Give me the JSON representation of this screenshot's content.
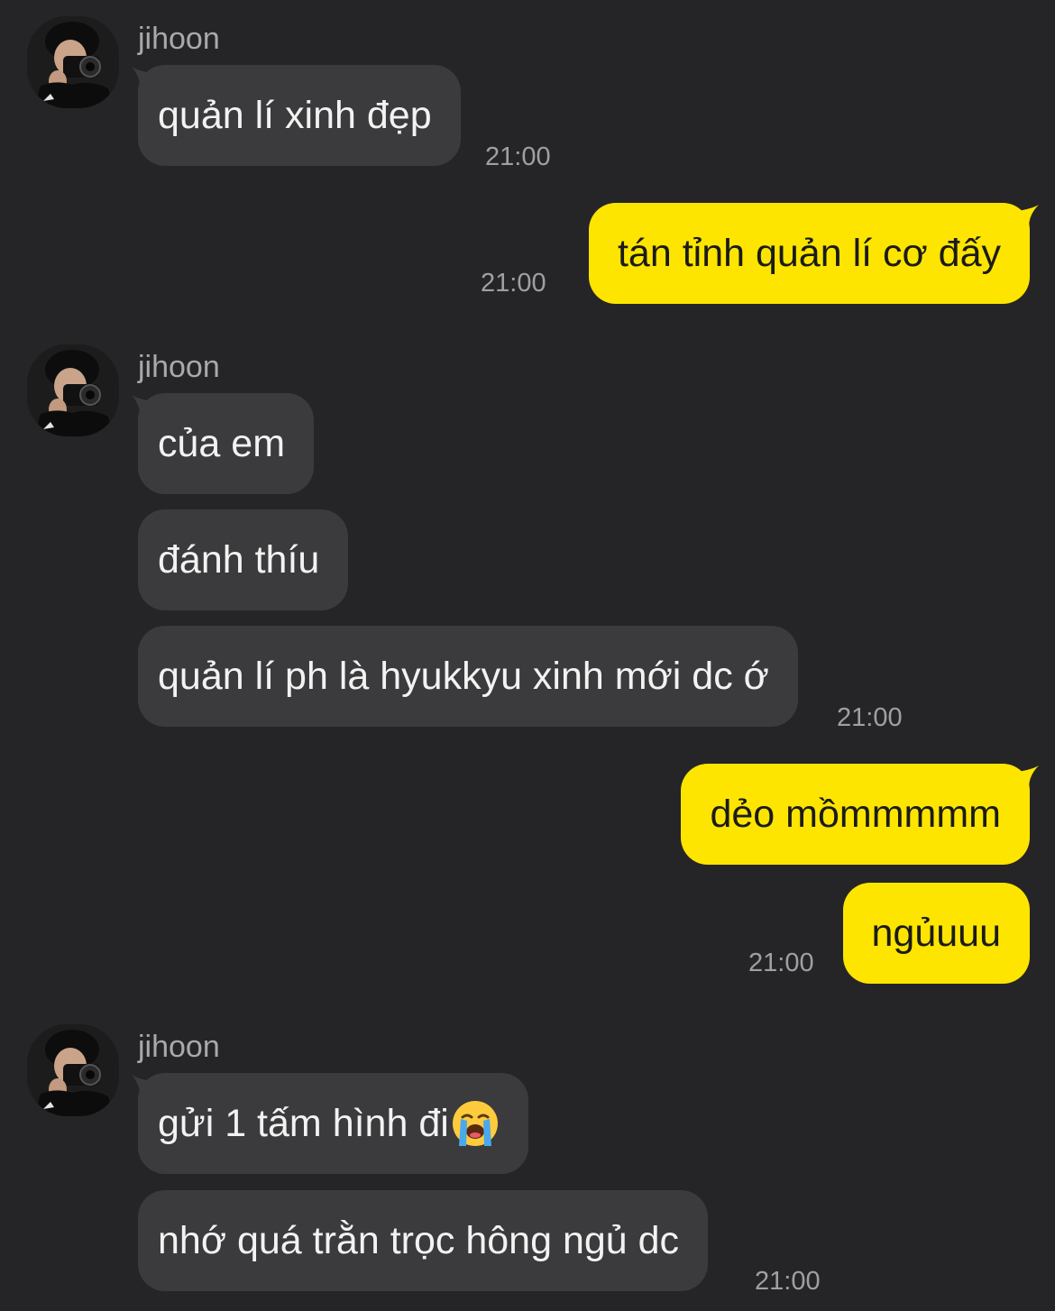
{
  "colors": {
    "background": "#252527",
    "incoming_bubble": "#3b3b3d",
    "outgoing_bubble": "#fde500",
    "incoming_text": "#f2f2f2",
    "outgoing_text": "#1b1b1b",
    "meta_text": "#a0a0a2"
  },
  "contact": {
    "name": "jihoon",
    "avatar_icon": "profile-photo-camera"
  },
  "groups": [
    {
      "from": "contact",
      "sender": "jihoon",
      "messages": [
        "quản lí xinh đẹp"
      ],
      "time": "21:00"
    },
    {
      "from": "me",
      "messages": [
        "tán tỉnh quản lí cơ đấy"
      ],
      "time": "21:00"
    },
    {
      "from": "contact",
      "sender": "jihoon",
      "messages": [
        "của em",
        "đánh thíu",
        "quản lí ph là hyukkyu xinh mới dc ớ"
      ],
      "time": "21:00"
    },
    {
      "from": "me",
      "messages": [
        "dẻo mồmmmmm",
        "ngủuuu"
      ],
      "time": "21:00"
    },
    {
      "from": "contact",
      "sender": "jihoon",
      "messages": [
        "gửi 1 tấm hình đi",
        "nhớ quá trằn trọc hông ngủ dc"
      ],
      "emoji": "loudly-crying-face",
      "time": "21:00"
    }
  ]
}
